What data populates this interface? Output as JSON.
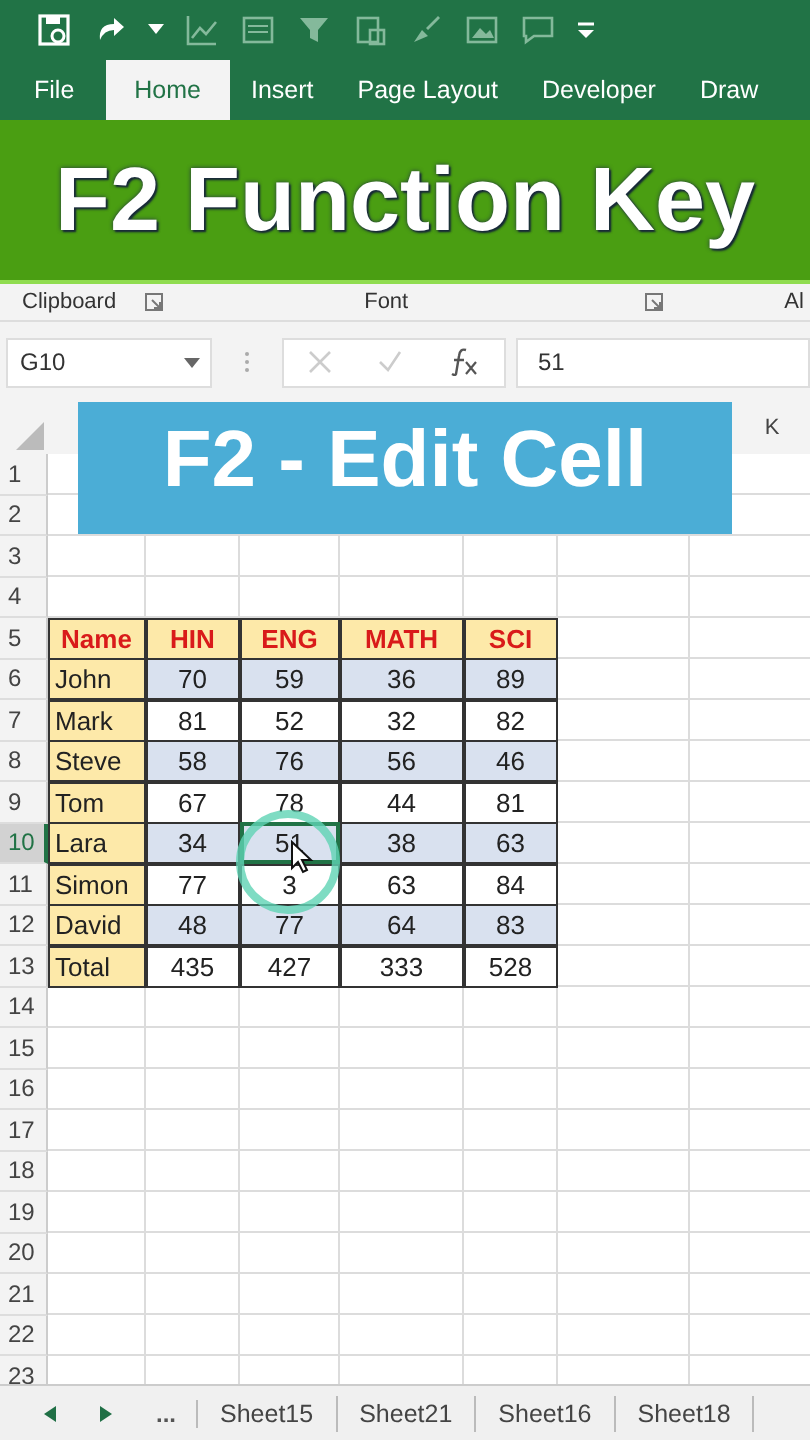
{
  "ribbon_tabs": [
    {
      "label": "File",
      "selected": false
    },
    {
      "label": "Home",
      "selected": true
    },
    {
      "label": "Insert",
      "selected": false
    },
    {
      "label": "Page Layout",
      "selected": false
    },
    {
      "label": "Developer",
      "selected": false
    },
    {
      "label": "Draw",
      "selected": false
    }
  ],
  "title_banner": "F2 Function Key",
  "ribbon_groups": [
    "Clipboard",
    "Font",
    "Al"
  ],
  "name_box": "G10",
  "formula": "51",
  "column_header": "K",
  "overlay_banner": "F2 - Edit Cell",
  "rows": [
    {
      "number": "1"
    },
    {
      "number": "2"
    },
    {
      "number": "3"
    },
    {
      "number": "4"
    },
    {
      "number": "5",
      "selected": false,
      "cells": [
        {
          "text": "Name",
          "kind": "header",
          "selected": false
        },
        {
          "text": "HIN",
          "kind": "header",
          "selected": false
        },
        {
          "text": "ENG",
          "kind": "header",
          "selected": false
        },
        {
          "text": "MATH",
          "kind": "header",
          "selected": false
        },
        {
          "text": "SCI",
          "kind": "header",
          "selected": false
        }
      ]
    },
    {
      "number": "6",
      "selected": false,
      "shaded": true,
      "cells": [
        {
          "text": "John",
          "kind": "name",
          "selected": false
        },
        {
          "text": "70",
          "kind": "value",
          "selected": false
        },
        {
          "text": "59",
          "kind": "value",
          "selected": false
        },
        {
          "text": "36",
          "kind": "value",
          "selected": false
        },
        {
          "text": "89",
          "kind": "value",
          "selected": false
        }
      ]
    },
    {
      "number": "7",
      "selected": false,
      "shaded": false,
      "cells": [
        {
          "text": "Mark",
          "kind": "name",
          "selected": false
        },
        {
          "text": "81",
          "kind": "value",
          "selected": false
        },
        {
          "text": "52",
          "kind": "value",
          "selected": false
        },
        {
          "text": "32",
          "kind": "value",
          "selected": false
        },
        {
          "text": "82",
          "kind": "value",
          "selected": false
        }
      ]
    },
    {
      "number": "8",
      "selected": false,
      "shaded": true,
      "cells": [
        {
          "text": "Steve",
          "kind": "name",
          "selected": false
        },
        {
          "text": "58",
          "kind": "value",
          "selected": false
        },
        {
          "text": "76",
          "kind": "value",
          "selected": false
        },
        {
          "text": "56",
          "kind": "value",
          "selected": false
        },
        {
          "text": "46",
          "kind": "value",
          "selected": false
        }
      ]
    },
    {
      "number": "9",
      "selected": false,
      "shaded": false,
      "cells": [
        {
          "text": "Tom",
          "kind": "name",
          "selected": false
        },
        {
          "text": "67",
          "kind": "value",
          "selected": false
        },
        {
          "text": "78",
          "kind": "value",
          "selected": false
        },
        {
          "text": "44",
          "kind": "value",
          "selected": false
        },
        {
          "text": "81",
          "kind": "value",
          "selected": false
        }
      ]
    },
    {
      "number": "10",
      "selected": true,
      "shaded": true,
      "cells": [
        {
          "text": "Lara",
          "kind": "name",
          "selected": false
        },
        {
          "text": "34",
          "kind": "value",
          "selected": false
        },
        {
          "text": "51",
          "kind": "value",
          "selected": true
        },
        {
          "text": "38",
          "kind": "value",
          "selected": false
        },
        {
          "text": "63",
          "kind": "value",
          "selected": false
        }
      ]
    },
    {
      "number": "11",
      "selected": false,
      "shaded": false,
      "cells": [
        {
          "text": "Simon",
          "kind": "name",
          "selected": false
        },
        {
          "text": "77",
          "kind": "value",
          "selected": false
        },
        {
          "text": "3",
          "kind": "value",
          "selected": false
        },
        {
          "text": "63",
          "kind": "value",
          "selected": false
        },
        {
          "text": "84",
          "kind": "value",
          "selected": false
        }
      ]
    },
    {
      "number": "12",
      "selected": false,
      "shaded": true,
      "cells": [
        {
          "text": "David",
          "kind": "name",
          "selected": false
        },
        {
          "text": "48",
          "kind": "value",
          "selected": false
        },
        {
          "text": "77",
          "kind": "value",
          "selected": false
        },
        {
          "text": "64",
          "kind": "value",
          "selected": false
        },
        {
          "text": "83",
          "kind": "value",
          "selected": false
        }
      ]
    },
    {
      "number": "13",
      "selected": false,
      "shaded": false,
      "cells": [
        {
          "text": "Total",
          "kind": "name",
          "selected": false
        },
        {
          "text": "435",
          "kind": "value",
          "selected": false
        },
        {
          "text": "427",
          "kind": "value",
          "selected": false
        },
        {
          "text": "333",
          "kind": "value",
          "selected": false
        },
        {
          "text": "528",
          "kind": "value",
          "selected": false
        }
      ]
    },
    {
      "number": "14"
    },
    {
      "number": "15"
    },
    {
      "number": "16"
    },
    {
      "number": "17"
    },
    {
      "number": "18"
    },
    {
      "number": "19"
    },
    {
      "number": "20"
    },
    {
      "number": "21"
    },
    {
      "number": "22"
    },
    {
      "number": "23"
    }
  ],
  "sheet_more": "...",
  "sheet_tabs": [
    {
      "label": "Sheet15",
      "selected": false
    },
    {
      "label": "Sheet21",
      "selected": false
    },
    {
      "label": "Sheet16",
      "selected": false
    },
    {
      "label": "Sheet18",
      "selected": false
    }
  ]
}
